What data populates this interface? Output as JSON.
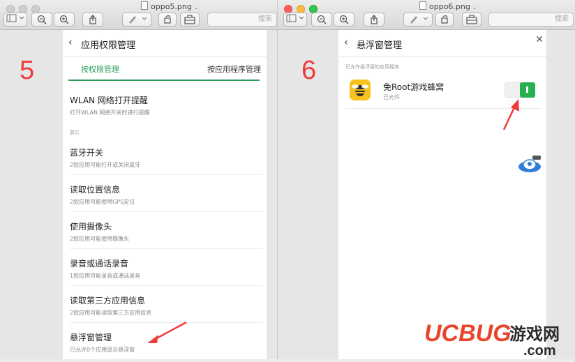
{
  "window1": {
    "title": "oppo5.png",
    "search_placeholder": "搜索",
    "screen": {
      "header_title": "应用权限管理",
      "tabs": [
        {
          "label": "按权限管理",
          "active": true
        },
        {
          "label": "按应用程序管理",
          "active": false
        }
      ],
      "items": [
        {
          "title": "WLAN 网络打开提醒",
          "subtitle": "打开WLAN 网络开关时进行提醒"
        },
        {
          "title": "蓝牙开关",
          "subtitle": "2款应用可能打开或关闭蓝牙"
        },
        {
          "title": "读取位置信息",
          "subtitle": "2款应用可能使用GPS定位"
        },
        {
          "title": "使用摄像头",
          "subtitle": "2款应用可能使用摄像头"
        },
        {
          "title": "录音或通话录音",
          "subtitle": "1款应用可能录音或通话录音"
        },
        {
          "title": "读取第三方应用信息",
          "subtitle": "2款应用可能读取第三方应用信息"
        },
        {
          "title": "悬浮窗管理",
          "subtitle": "已允许0个应用显示悬浮窗"
        }
      ],
      "section_other": "其它"
    },
    "step_number": "5"
  },
  "window2": {
    "title": "oppo6.png",
    "search_placeholder": "搜索",
    "screen": {
      "header_title": "悬浮窗管理",
      "section_label": "已允许悬浮窗的应用程序",
      "app": {
        "name": "免Root游戏蜂窝",
        "status": "已允许",
        "toggle_on": true
      }
    },
    "step_number": "6"
  },
  "watermark": {
    "brand": "UCBUG",
    "suffix": "游戏网",
    "domain": ".com"
  },
  "colors": {
    "accent_green": "#2e9e5e",
    "toggle_green": "#27b052",
    "annotation_red": "#ee3b3b"
  }
}
